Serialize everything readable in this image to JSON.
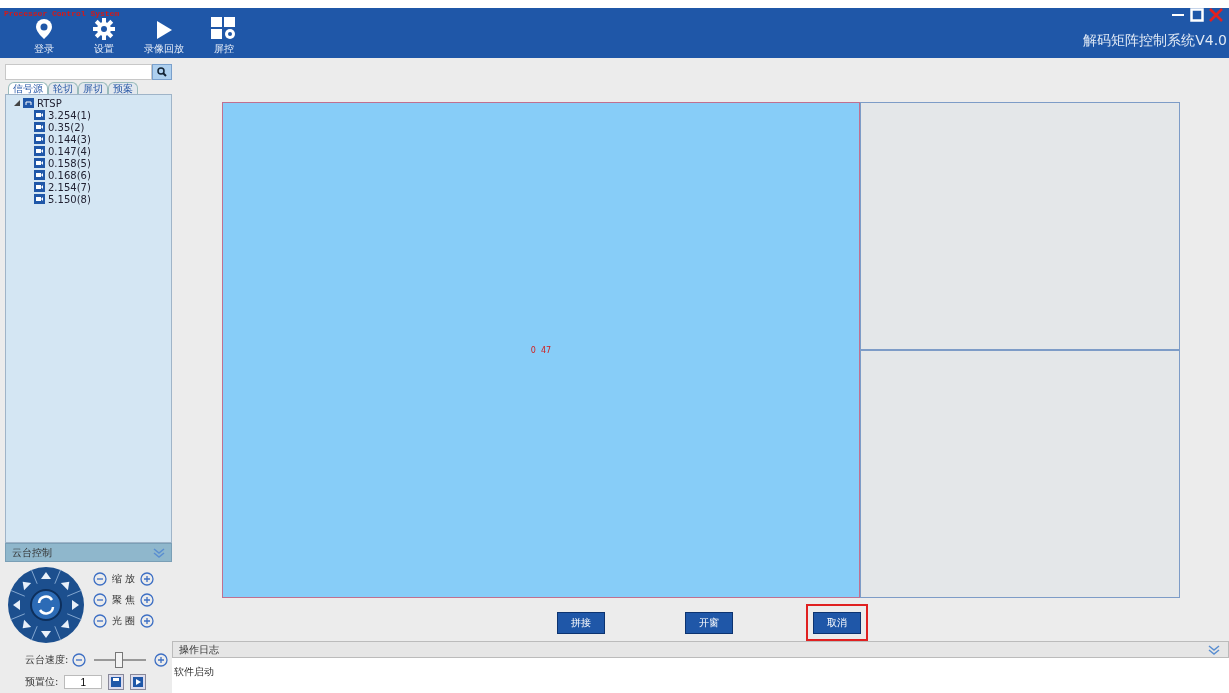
{
  "window": {
    "caption": "Processor Control System",
    "title": "解码矩阵控制系统V4.0"
  },
  "toolbar": [
    {
      "label": "登录",
      "kind": "pin"
    },
    {
      "label": "设置",
      "kind": "gear"
    },
    {
      "label": "录像回放",
      "kind": "play"
    },
    {
      "label": "屏控",
      "kind": "screens"
    }
  ],
  "tabs": [
    {
      "label": "信号源",
      "selected": true
    },
    {
      "label": "轮切",
      "selected": false
    },
    {
      "label": "屏切",
      "selected": false
    },
    {
      "label": "预案",
      "selected": false
    }
  ],
  "tree": [
    {
      "label": "RTSP",
      "expanded": true,
      "children": [
        {
          "label": "3.254(1)"
        },
        {
          "label": "0.35(2)"
        },
        {
          "label": "0.144(3)"
        },
        {
          "label": "0.147(4)"
        },
        {
          "label": "0.158(5)"
        },
        {
          "label": "0.168(6)"
        },
        {
          "label": "2.154(7)"
        },
        {
          "label": "5.150(8)"
        }
      ]
    }
  ],
  "ptz": {
    "title": "云台控制",
    "adjust": [
      {
        "label": "缩 放"
      },
      {
        "label": "聚 焦"
      },
      {
        "label": "光 圈"
      }
    ],
    "speed": {
      "label": "云台速度:",
      "level": 0.48
    },
    "preset": {
      "label": "预置位:",
      "value": "1"
    }
  },
  "screen": {
    "cells": [
      {
        "label": "0  47",
        "selected": true
      },
      {
        "selected": false
      },
      {
        "selected": false
      }
    ]
  },
  "buttons": [
    {
      "label": "拼接",
      "highlighted": false
    },
    {
      "label": "开窗",
      "highlighted": false
    },
    {
      "label": "取消",
      "highlighted": true
    }
  ],
  "log": {
    "title": "操作日志",
    "lines": [
      "软件启动"
    ]
  }
}
